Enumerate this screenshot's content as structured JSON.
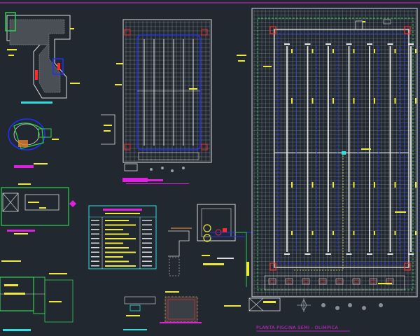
{
  "app": {
    "viewport": "cad-model-space"
  },
  "drawing": {
    "main_plan_title": "PLANTA  PISCINA SEMI - OLIMPICA",
    "colors": {
      "background": "#212830",
      "frame_white": "#dcdcdc",
      "grid_gray": "#8a8f96",
      "lane_white": "#e6e6e6",
      "pipe_blue": "#2030ff",
      "dim_yellow": "#f0e83a",
      "title_magenta": "#e020e0",
      "fitting_red": "#ff2a2a",
      "text_cyan": "#30e0e0",
      "pipe_green": "#30d050",
      "hatch_orange": "#e08030"
    },
    "icons": [
      "north-arrow-icon",
      "section-marker-icon",
      "pump-symbol-icon",
      "valve-symbol-icon"
    ]
  }
}
